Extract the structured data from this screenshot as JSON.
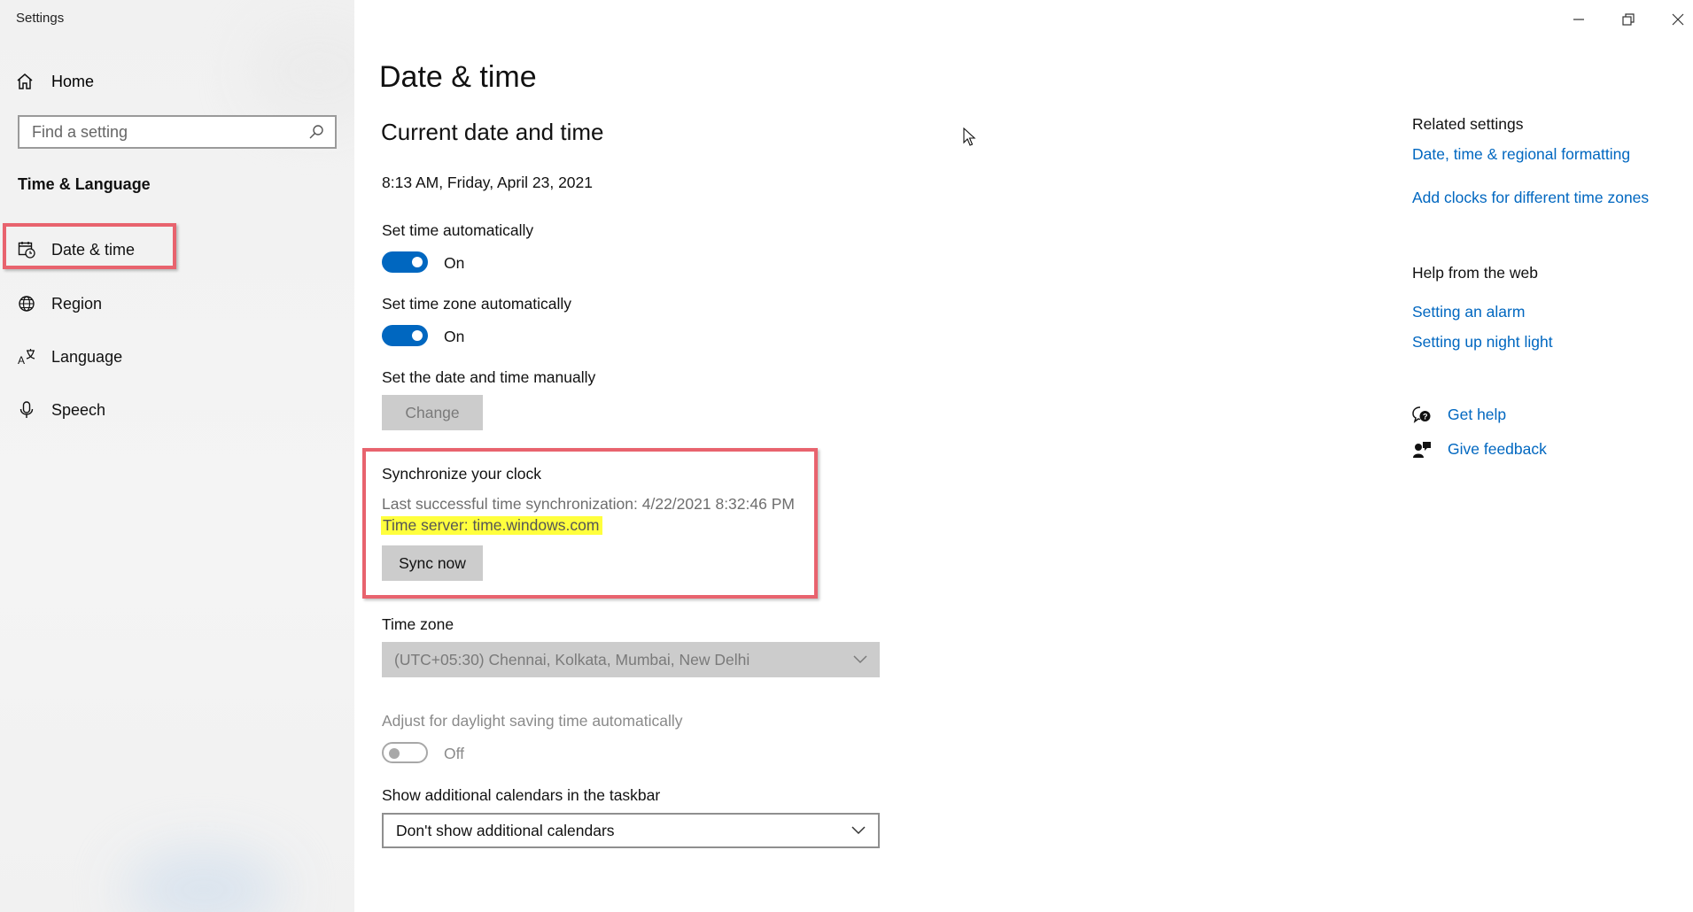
{
  "app": {
    "title": "Settings"
  },
  "window_controls": {
    "minimize": "minimize-icon",
    "restore": "restore-icon",
    "close": "close-icon"
  },
  "sidebar": {
    "home_label": "Home",
    "search_placeholder": "Find a setting",
    "section": "Time & Language",
    "items": [
      {
        "label": "Date & time",
        "icon": "calendar-clock-icon",
        "selected": true
      },
      {
        "label": "Region",
        "icon": "globe-icon"
      },
      {
        "label": "Language",
        "icon": "language-icon"
      },
      {
        "label": "Speech",
        "icon": "microphone-icon"
      }
    ]
  },
  "main": {
    "title": "Date & time",
    "section_title": "Current date and time",
    "current_datetime": "8:13 AM, Friday, April 23, 2021",
    "set_time_auto": {
      "label": "Set time automatically",
      "state": "On"
    },
    "set_timezone_auto": {
      "label": "Set time zone automatically",
      "state": "On"
    },
    "manual": {
      "label": "Set the date and time manually",
      "button": "Change"
    },
    "sync": {
      "title": "Synchronize your clock",
      "last_sync": "Last successful time synchronization: 4/22/2021 8:32:46 PM",
      "time_server": "Time server: time.windows.com",
      "button": "Sync now"
    },
    "timezone": {
      "label": "Time zone",
      "value": "(UTC+05:30) Chennai, Kolkata, Mumbai, New Delhi"
    },
    "dst": {
      "label": "Adjust for daylight saving time automatically",
      "state": "Off"
    },
    "calendars": {
      "label": "Show additional calendars in the taskbar",
      "value": "Don't show additional calendars"
    }
  },
  "right": {
    "related_heading": "Related settings",
    "related_links": [
      "Date, time & regional formatting",
      "Add clocks for different time zones"
    ],
    "help_heading": "Help from the web",
    "help_links": [
      "Setting an alarm",
      "Setting up night light"
    ],
    "get_help": "Get help",
    "give_feedback": "Give feedback"
  },
  "colors": {
    "accent": "#0067c0",
    "annotation_box": "#e8636e",
    "highlight": "#ffff3d"
  }
}
